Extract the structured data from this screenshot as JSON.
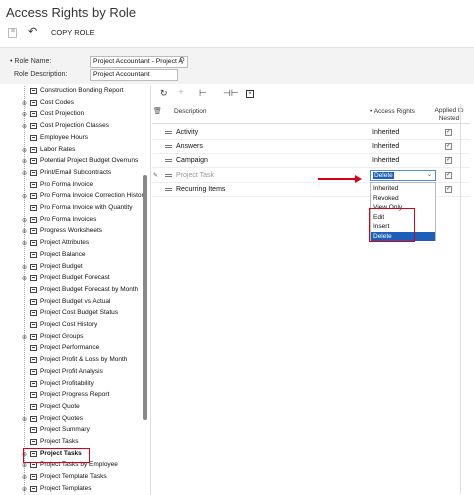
{
  "page": {
    "title": "Access Rights by Role"
  },
  "toolbar": {
    "copy_role_label": "COPY ROLE"
  },
  "header": {
    "role_name_label": "• Role Name:",
    "role_name_value": "Project Accountant - Project A",
    "role_desc_label": "Role Description:",
    "role_desc_value": "Project Accountant"
  },
  "tree": {
    "items": [
      {
        "label": "Construction Bonding Report",
        "expandable": false
      },
      {
        "label": "Cost Codes",
        "expandable": true
      },
      {
        "label": "Cost Projection",
        "expandable": true
      },
      {
        "label": "Cost Projection Classes",
        "expandable": true
      },
      {
        "label": "Employee Hours",
        "expandable": false
      },
      {
        "label": "Labor Rates",
        "expandable": true
      },
      {
        "label": "Potential Project Budget Overruns",
        "expandable": true
      },
      {
        "label": "Print/Email Subcontracts",
        "expandable": true
      },
      {
        "label": "Pro Forma Invoice",
        "expandable": false
      },
      {
        "label": "Pro Forma Invoice Correction Histor",
        "expandable": true
      },
      {
        "label": "Pro Forma Invoice with Quantity",
        "expandable": false
      },
      {
        "label": "Pro Forma Invoices",
        "expandable": true
      },
      {
        "label": "Progress Worksheets",
        "expandable": true
      },
      {
        "label": "Project Attributes",
        "expandable": true
      },
      {
        "label": "Project Balance",
        "expandable": false
      },
      {
        "label": "Project Budget",
        "expandable": true
      },
      {
        "label": "Project Budget Forecast",
        "expandable": true
      },
      {
        "label": "Project Budget Forecast by Month",
        "expandable": false
      },
      {
        "label": "Project Budget vs Actual",
        "expandable": false
      },
      {
        "label": "Project Cost Budget Status",
        "expandable": false
      },
      {
        "label": "Project Cost History",
        "expandable": false
      },
      {
        "label": "Project Groups",
        "expandable": true
      },
      {
        "label": "Project Performance",
        "expandable": false
      },
      {
        "label": "Project Profit & Loss by Month",
        "expandable": false
      },
      {
        "label": "Project Profit Analysis",
        "expandable": false
      },
      {
        "label": "Project Profitability",
        "expandable": false
      },
      {
        "label": "Project Progress Report",
        "expandable": false
      },
      {
        "label": "Project Quote",
        "expandable": false
      },
      {
        "label": "Project Quotes",
        "expandable": true
      },
      {
        "label": "Project Summary",
        "expandable": false
      },
      {
        "label": "Project Tasks",
        "expandable": false
      },
      {
        "label": "Project Tasks",
        "expandable": true,
        "selected": true
      },
      {
        "label": "Project Tasks by Employee",
        "expandable": true
      },
      {
        "label": "Project Template Tasks",
        "expandable": true
      },
      {
        "label": "Project Templates",
        "expandable": true
      }
    ]
  },
  "grid": {
    "columns": {
      "description": "Description",
      "access_rights": "• Access Rights",
      "applied": "Applied to Nested"
    },
    "rows": [
      {
        "description": "Activity",
        "access_rights": "Inherited"
      },
      {
        "description": "Answers",
        "access_rights": "Inherited"
      },
      {
        "description": "Campaign",
        "access_rights": "Inherited"
      },
      {
        "description": "Project Task",
        "access_rights": "Delete"
      },
      {
        "description": "Recurring Items",
        "access_rights": ""
      }
    ],
    "dropdown_options": [
      "Inherited",
      "Revoked",
      "View Only",
      "Edit",
      "Insert",
      "Delete"
    ],
    "dropdown_selected": "Delete"
  }
}
